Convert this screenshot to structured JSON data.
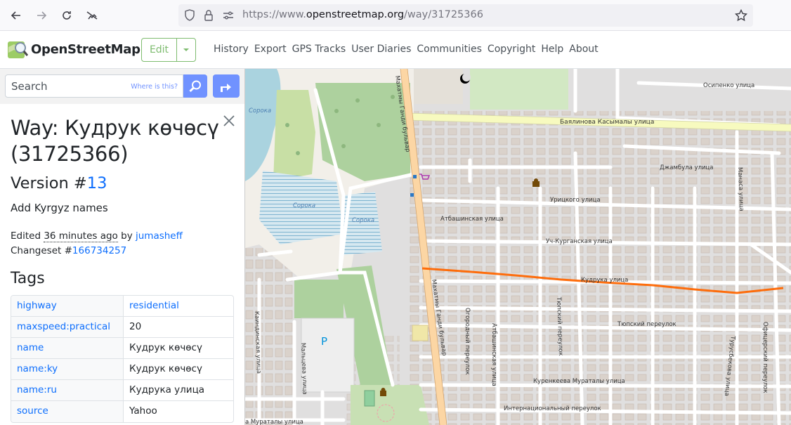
{
  "browser": {
    "url_prefix": "https://www.",
    "url_host": "openstreetmap.org",
    "url_path": "/way/31725366"
  },
  "header": {
    "brand": "OpenStreetMap",
    "edit_label": "Edit",
    "nav": [
      "History",
      "Export",
      "GPS Tracks",
      "User Diaries",
      "Communities",
      "Copyright",
      "Help",
      "About"
    ]
  },
  "search": {
    "placeholder": "Search",
    "where_is_this": "Where is this?"
  },
  "feature": {
    "title": "Way: Кудрук көчөсү (31725366)",
    "version_prefix": "Version #",
    "version_number": "13",
    "comment": "Add Kyrgyz names",
    "edited_prefix": "Edited ",
    "edited_time": "36 minutes ago",
    "edited_by": " by ",
    "user": "jumasheff",
    "changeset_prefix": "Changeset #",
    "changeset": "166734257"
  },
  "tags": {
    "heading": "Tags",
    "rows": [
      {
        "key": "highway",
        "value": "residential",
        "value_link": true
      },
      {
        "key": "maxspeed:practical",
        "value": "20",
        "value_link": false
      },
      {
        "key": "name",
        "value": "Кудрук көчөсү",
        "value_link": false
      },
      {
        "key": "name:ky",
        "value": "Кудрук көчөсү",
        "value_link": false
      },
      {
        "key": "name:ru",
        "value": "Кудрука улица",
        "value_link": false
      },
      {
        "key": "source",
        "value": "Yahoo",
        "value_link": false
      }
    ]
  },
  "map": {
    "labels": {
      "sorok1": "Сорока",
      "sorok2": "Сорока",
      "sorok3": "Сорока",
      "bayalin": "Баялинова Касымалы улица",
      "osipenko": "Осипенко улица",
      "zhambyl": "Джамбула улица",
      "urits": "Урицкого улица",
      "atbashi": "Атбашинская улица",
      "uch": "Уч-Курганская улица",
      "kudruk": "Кудрука улица",
      "tyup": "Тюпский переулок",
      "kurenk": "Куренкеева Мураталы улица",
      "internat": "Интернациональный переулок",
      "mahatma": "Махатмы Ганди бульвар",
      "mahatma2": "Махатмы Ганди бульвар",
      "manas": "Манаса улица",
      "malcev": "Мальцева улица",
      "kaindy": "Каиндинская улица",
      "ogorod": "Огородный переулок",
      "atbashi2": "Атбашинская улица",
      "tyup2": "Тюпский переулок",
      "turus": "Турусбекова улица",
      "ofic": "Офицерский переулок",
      "murat2": "а Мураталы улица",
      "parking": "P"
    },
    "colors": {
      "highlight": "#ff6600",
      "land": "#e0dfdf",
      "building": "#d9d0c9",
      "water": "#aad3df",
      "park": "#add19e",
      "primary": "#fcd6a4",
      "secondary": "#f7fabf"
    }
  }
}
